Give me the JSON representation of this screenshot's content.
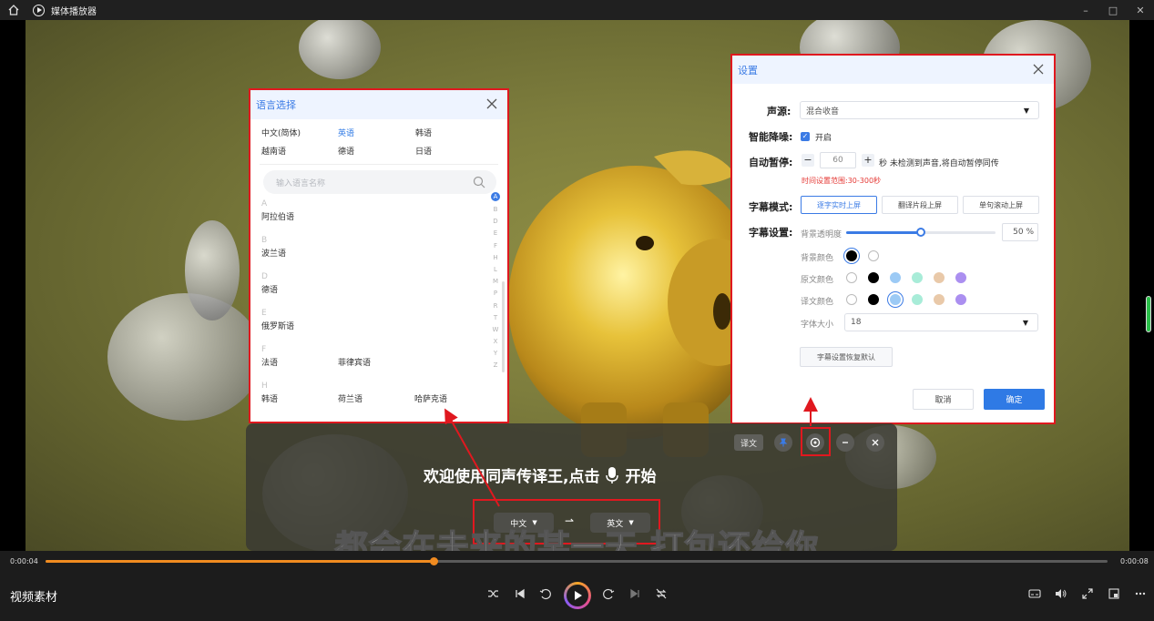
{
  "titlebar": {
    "app_title": "媒体播放器",
    "minimize": "–",
    "maximize": "□",
    "close": "✕"
  },
  "language_dialog": {
    "title": "语言选择",
    "quick_languages": [
      "中文(简体)",
      "英语",
      "韩语",
      "越南语",
      "德语",
      "日语"
    ],
    "active_quick": "英语",
    "search_placeholder": "输入语言名称",
    "groups": [
      {
        "letter": "A",
        "items": [
          "阿拉伯语"
        ]
      },
      {
        "letter": "B",
        "items": [
          "波兰语"
        ]
      },
      {
        "letter": "D",
        "items": [
          "德语"
        ]
      },
      {
        "letter": "E",
        "items": [
          "俄罗斯语"
        ]
      },
      {
        "letter": "F",
        "items": [
          "法语",
          "菲律宾语"
        ]
      },
      {
        "letter": "H",
        "items": [
          "韩语",
          "荷兰语",
          "哈萨克语"
        ]
      }
    ],
    "index_letters": [
      "A",
      "B",
      "D",
      "E",
      "F",
      "H",
      "L",
      "M",
      "P",
      "R",
      "T",
      "W",
      "X",
      "Y",
      "Z"
    ]
  },
  "settings_dialog": {
    "title": "设置",
    "source_label": "声源:",
    "source_value": "混合收音",
    "noise_label": "智能降噪:",
    "noise_option": "开启",
    "noise_checked": true,
    "autopause_label": "自动暂停:",
    "autopause_value": "60",
    "autopause_desc": "秒 未检测到声音,将自动暂停同传",
    "autopause_hint": "时间设置范围:30-300秒",
    "mode_label": "字幕模式:",
    "modes": [
      "逐字实时上屏",
      "翻译片段上屏",
      "单句滚动上屏"
    ],
    "active_mode": "逐字实时上屏",
    "subtitle_settings_label": "字幕设置:",
    "opacity_label": "背景透明度",
    "opacity_value": "50 %",
    "opacity_fraction": 0.5,
    "bg_color_label": "背景颜色",
    "source_color_label": "原文颜色",
    "trans_color_label": "译文颜色",
    "bg_colors": [
      "#000000",
      "#ffffff"
    ],
    "source_colors": [
      "#ffffff",
      "#000000",
      "#9ccaf5",
      "#a8ecd8",
      "#e9c9a9",
      "#ab8ff0"
    ],
    "trans_colors": [
      "#ffffff",
      "#000000",
      "#9ccaf5",
      "#a8ecd8",
      "#e9c9a9",
      "#ab8ff0"
    ],
    "font_size_label": "字体大小",
    "font_size_value": "18",
    "reset_label": "字幕设置恢复默认",
    "cancel_label": "取消",
    "ok_label": "确定"
  },
  "translator": {
    "yiwen_label": "译文",
    "welcome_before": "欢迎使用同声传译王,点击",
    "welcome_after": "开始",
    "source_lang": "中文",
    "target_lang": "英文",
    "swap_glyph": "⇀"
  },
  "subtitle_text": "都会在未来的某一天 打包还给你",
  "player": {
    "current_time": "0:00:04",
    "total_time": "0:00:08",
    "progress_fraction": 0.365,
    "video_name": "视频素材"
  },
  "colors": {
    "accent": "#3b7be5",
    "annotation_red": "#e0181f",
    "progress": "#f08b20"
  }
}
